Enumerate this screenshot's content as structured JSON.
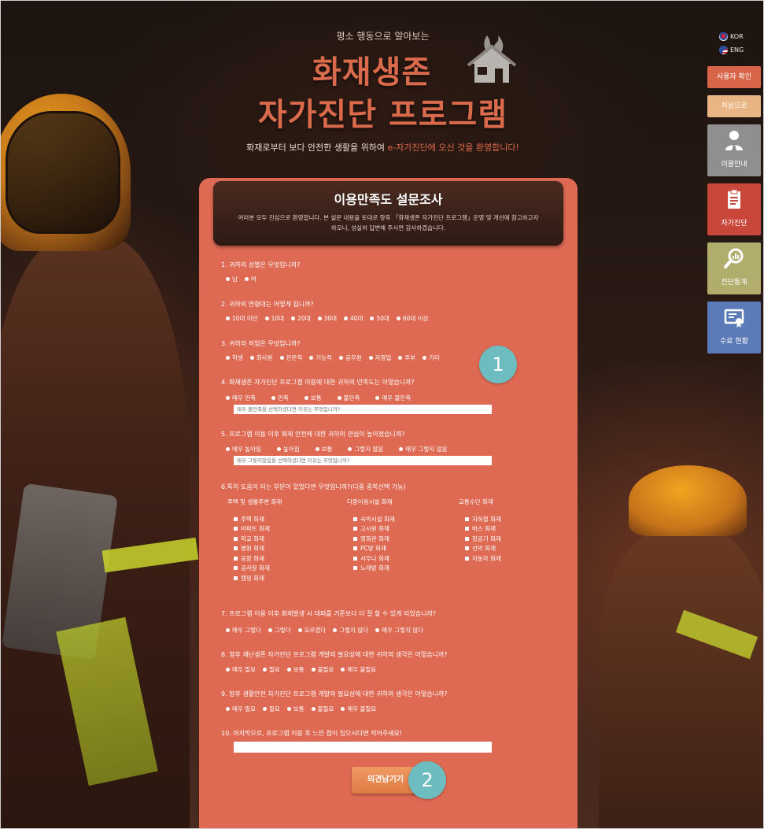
{
  "header": {
    "subtitle": "평소 행동으로 알아보는",
    "title_line1": "화재생존",
    "title_line2": "자가진단 프로그램",
    "welcome_prefix": "화재로부터 보다 안전한 생활을 위하여 ",
    "welcome_highlight": "e-자가진단에 오신 것을 환영합니다!"
  },
  "language": {
    "kor": "KOR",
    "eng": "ENG"
  },
  "side_menu": {
    "user_check": "사용자 확인",
    "first_visit": "처음으로",
    "guide": "이용안내",
    "self_diagnosis": "자가진단",
    "statistics": "진단통계",
    "award_status": "수료 현황"
  },
  "survey": {
    "title": "이용만족도 설문조사",
    "description": "여러분 모두 진심으로 환영합니다. 본 설문 내용을 토대로 향후 「화재생존 자가진단 프로그램」운영 및 개선에 참고하고자 하오니, 성실히 답변해 주시면 감사하겠습니다.",
    "q1": {
      "label": "1. 귀하의 성별은 무엇입니까?",
      "options": [
        "남",
        "여"
      ]
    },
    "q2": {
      "label": "2. 귀하의 연령대는 어떻게 됩니까?",
      "options": [
        "10대 미만",
        "10대",
        "20대",
        "30대",
        "40대",
        "50대",
        "60대 이상"
      ]
    },
    "q3": {
      "label": "3. 귀하의 직업은 무엇입니까?",
      "options": [
        "학생",
        "회사원",
        "전문직",
        "기능직",
        "공무원",
        "자영업",
        "주부",
        "기타"
      ]
    },
    "q4": {
      "label": "4. 화재생존 자가진단 프로그램 이용에 대한 귀하의 만족도는 어떻습니까?",
      "options": [
        "매우 만족",
        "만족",
        "보통",
        "불만족",
        "매우 불만족"
      ],
      "placeholder": "매우 불만족을 선택하셨다면 이유는 무엇입니까?"
    },
    "q5": {
      "label": "5. 프로그램 이용 이후 화재 안전에 대한 귀하의 관심이 높아졌습니까?",
      "options": [
        "매우 높아짐",
        "높아짐",
        "보통",
        "그렇지 않음",
        "매우 그렇지 않음"
      ],
      "placeholder": "매우 그렇지않음을 선택하셨다면 이유는 무엇입니까?"
    },
    "q6": {
      "label": "6.특히 도움이 되는 부분이 있었다면 무엇입니까?(다중 중복선택 가능)",
      "groups": [
        {
          "title": "주택 및 생활주변 화재",
          "items": [
            "주택 화재",
            "아파트 화재",
            "학교 화재",
            "병원 화재",
            "공장 화재",
            "공사장 화재",
            "캠핑 화재"
          ]
        },
        {
          "title": "다중이용시설 화재",
          "items": [
            "숙박시설 화재",
            "고시원 화재",
            "영화관 화재",
            "PC방 화재",
            "사우나 화재",
            "노래방 화재"
          ]
        },
        {
          "title": "교통수단 화재",
          "items": [
            "지하철 화재",
            "버스 화재",
            "항공기 화재",
            "선박 화재",
            "자동차 화재"
          ]
        }
      ]
    },
    "q7": {
      "label": "7. 프로그램 이용 이후 화재발생 시 대피를 기준보다 더 잘 할 수 있게 되었습니까?",
      "options": [
        "매우 그렇다",
        "그렇다",
        "모르겠다",
        "그렇지 않다",
        "매우 그렇지 않다"
      ]
    },
    "q8": {
      "label": "8. 향후 재난생존 자가진단 프로그램 개발의 필요성에 대한 귀하의 생각은 어떻습니까?",
      "options": [
        "매우 필요",
        "필요",
        "보통",
        "불필요",
        "매우 불필요"
      ]
    },
    "q9": {
      "label": "9. 향후 생활안전 자가진단 프로그램 개발의 필요성에 대한 귀하의 생각은 어떻습니까?",
      "options": [
        "매우 필요",
        "필요",
        "보통",
        "불필요",
        "매우 불필요"
      ]
    },
    "q10": {
      "label": "10. 마지막으로, 프로그램 이용 후 느낀 점이 있으시다면 적어주세요!",
      "value": ""
    },
    "submit_label": "의견남기기"
  },
  "annotations": {
    "badge1": "1",
    "badge2": "2"
  },
  "colors": {
    "panel": "#de6a54",
    "title": "#d96a4c",
    "badge": "#6cbcc0"
  }
}
